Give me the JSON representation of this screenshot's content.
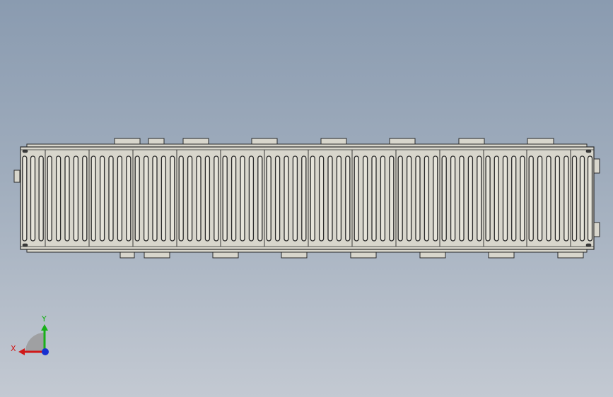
{
  "viewport": {
    "background_top": "#8a9bb0",
    "background_bottom": "#c3c9d2",
    "model": {
      "name": "conveyor-module-assembly",
      "body_color": "#d8d6cc",
      "edge_color": "#2a2a2a",
      "slot_fill_color": "#e6e4da"
    }
  },
  "triad": {
    "x_label": "X",
    "y_label": "Y",
    "x_color": "#d01818",
    "y_color": "#18b018",
    "z_color": "#1830d0"
  }
}
